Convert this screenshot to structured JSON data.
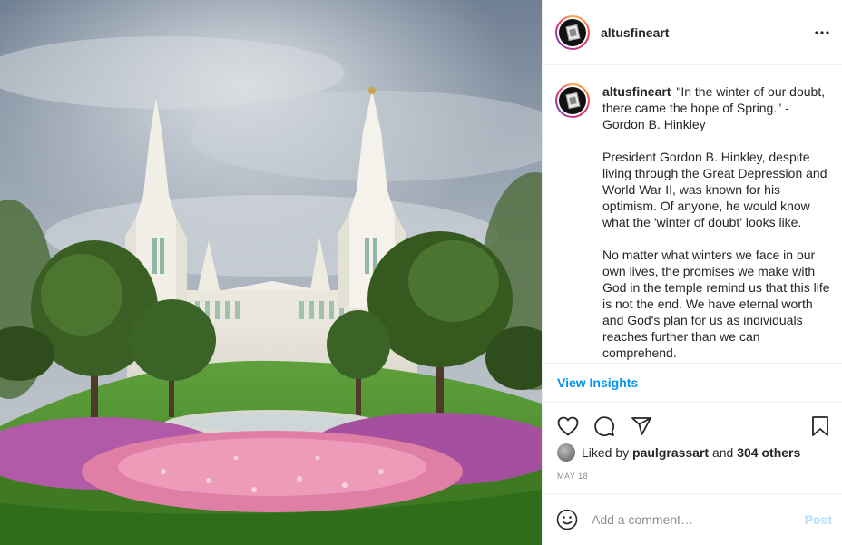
{
  "post": {
    "username": "altusfineart",
    "image_alt": "San Diego temple with spires, trees and pink flower gardens"
  },
  "header": {
    "username": "altusfineart",
    "more_icon": "more-horizontal-icon"
  },
  "caption": {
    "username": "altusfineart",
    "paragraphs": [
      "\"In the winter of our doubt, there came the hope of Spring.\" - Gordon B. Hinkley",
      "President Gordon B. Hinkley, despite living through the Great Depression and World War II, was known for his optimism. Of anyone, he would know what the 'winter of doubt' looks like.",
      "No matter what winters we face in our own lives, the promises we make with God in the temple remind us that this life is not the end. We have eternal worth and God's plan for us as individuals reaches further than we can comprehend."
    ]
  },
  "insights": {
    "label": "View Insights"
  },
  "actions": {
    "like_icon": "heart-icon",
    "comment_icon": "comment-icon",
    "share_icon": "share-icon",
    "save_icon": "bookmark-icon"
  },
  "likes": {
    "prefix": "Liked by",
    "user": "paulgrassart",
    "connector": "and",
    "others": "304 others"
  },
  "date": "MAY 18",
  "comment": {
    "placeholder": "Add a comment…",
    "post_label": "Post",
    "emoji_icon": "smiley-icon"
  },
  "colors": {
    "link_blue": "#0095f6",
    "post_disabled": "#b2dffc",
    "text": "#262626",
    "muted": "#8e8e8e"
  }
}
